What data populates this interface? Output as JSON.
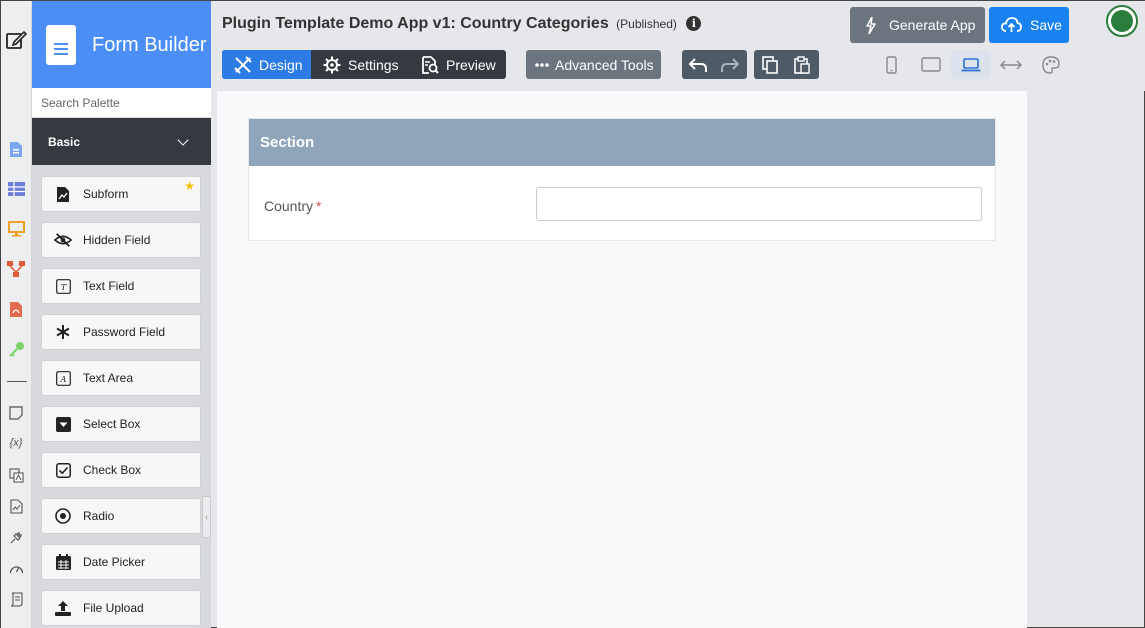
{
  "rail": {
    "icons": [
      "edit-icon",
      "document-icon",
      "table-icon",
      "monitor-icon",
      "flow-icon",
      "pdf-icon",
      "key-icon",
      "note-icon",
      "variable-icon",
      "translate-icon",
      "report-icon",
      "plugin-icon",
      "dashboard-icon",
      "script-icon"
    ],
    "variable_glyph": "{x}"
  },
  "palette": {
    "title": "Form Builder",
    "search_placeholder": "Search Palette",
    "category": "Basic",
    "items": [
      {
        "label": "Subform",
        "icon": "subform-icon",
        "starred": true
      },
      {
        "label": "Hidden Field",
        "icon": "eye-slash-icon"
      },
      {
        "label": "Text Field",
        "icon": "text-field-icon"
      },
      {
        "label": "Password Field",
        "icon": "asterisk-icon"
      },
      {
        "label": "Text Area",
        "icon": "text-area-icon"
      },
      {
        "label": "Select Box",
        "icon": "select-box-icon"
      },
      {
        "label": "Check Box",
        "icon": "checkbox-icon"
      },
      {
        "label": "Radio",
        "icon": "radio-icon"
      },
      {
        "label": "Date Picker",
        "icon": "calendar-icon"
      },
      {
        "label": "File Upload",
        "icon": "upload-icon"
      }
    ],
    "collapse_glyph": "‹"
  },
  "header": {
    "app_title": "Plugin Template Demo App v1: Country Categories",
    "status": "(Published)",
    "info_glyph": "i",
    "tabs": [
      {
        "label": "Design",
        "icon": "design-tools-icon",
        "active": true
      },
      {
        "label": "Settings",
        "icon": "gear-icon"
      },
      {
        "label": "Preview",
        "icon": "preview-icon"
      }
    ],
    "advanced_tools": "Advanced Tools",
    "generate_app": "Generate App",
    "save": "Save",
    "devices": [
      "phone-icon",
      "tablet-icon",
      "laptop-icon",
      "expand-width-icon",
      "palette-icon"
    ],
    "active_device": "laptop-icon"
  },
  "form": {
    "section_title": "Section",
    "field_label": "Country",
    "required_mark": "*",
    "field_value": ""
  },
  "colors": {
    "brand_blue": "#4b8ef5",
    "tab_active": "#2d7be5",
    "save_blue": "#1a82f0",
    "section_header": "#8fa5ba",
    "dark_panel": "#343a40"
  }
}
